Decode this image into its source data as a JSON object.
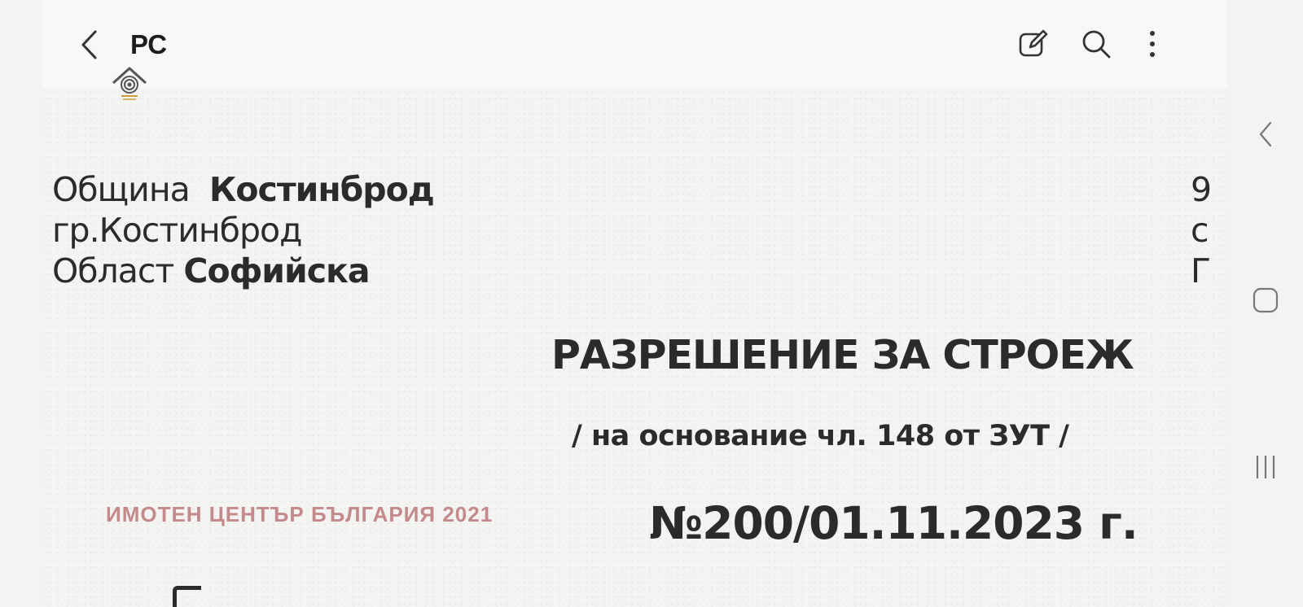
{
  "header": {
    "title": "РС",
    "back_icon": "chevron-left-icon",
    "actions": [
      {
        "name": "edit",
        "icon": "edit-icon"
      },
      {
        "name": "search",
        "icon": "search-icon"
      },
      {
        "name": "more",
        "icon": "more-vertical-icon"
      }
    ]
  },
  "document": {
    "municipality_label": "Община",
    "municipality_name": "Костинброд",
    "city": "гр.Костинброд",
    "region_label": "Област",
    "region_name": "Софийска",
    "title": "РАЗРЕШЕНИЕ ЗА СТРОЕЖ",
    "basis": "/ на основание чл. 148 от ЗУТ /",
    "number": "№200/01.11.2023  г.",
    "watermark": "ИМОТЕН ЦЕНТЪР БЪЛГАРИЯ 2021",
    "right_edge_fragments": [
      "9",
      "с",
      "Г"
    ]
  },
  "system_nav": {
    "back": "back-icon",
    "home": "home-icon",
    "recents": "recents-icon"
  },
  "colors": {
    "watermark": "#c4898b",
    "background": "#fbfbfd",
    "text": "#2b2b2e"
  }
}
